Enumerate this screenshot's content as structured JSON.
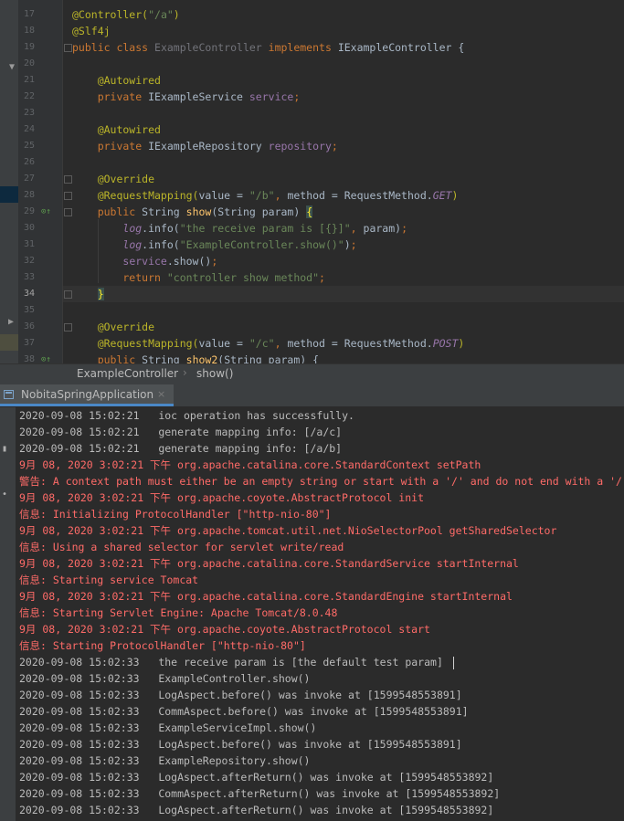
{
  "editor": {
    "lines": [
      {
        "n": "17",
        "tokens": [
          {
            "t": "@Controller(",
            "c": "ann"
          },
          {
            "t": "\"/a\"",
            "c": "str"
          },
          {
            "t": ")",
            "c": "ann"
          }
        ]
      },
      {
        "n": "18",
        "tokens": [
          {
            "t": "@Slf4j",
            "c": "ann"
          }
        ]
      },
      {
        "n": "19",
        "tokens": [
          {
            "t": "public class ",
            "c": "kw"
          },
          {
            "t": "ExampleController ",
            "c": "dim"
          },
          {
            "t": "implements ",
            "c": "kw"
          },
          {
            "t": "IExampleController {",
            "c": ""
          }
        ]
      },
      {
        "n": "20",
        "tokens": []
      },
      {
        "n": "21",
        "tokens": [
          {
            "t": "    @Autowired",
            "c": "ann"
          }
        ]
      },
      {
        "n": "22",
        "tokens": [
          {
            "t": "    private ",
            "c": "kw"
          },
          {
            "t": "IExampleService ",
            "c": ""
          },
          {
            "t": "service",
            "c": "fld"
          },
          {
            "t": ";",
            "c": "kw"
          }
        ]
      },
      {
        "n": "23",
        "tokens": []
      },
      {
        "n": "24",
        "tokens": [
          {
            "t": "    @Autowired",
            "c": "ann"
          }
        ]
      },
      {
        "n": "25",
        "tokens": [
          {
            "t": "    private ",
            "c": "kw"
          },
          {
            "t": "IExampleRepository ",
            "c": ""
          },
          {
            "t": "repository",
            "c": "fld"
          },
          {
            "t": ";",
            "c": "kw"
          }
        ]
      },
      {
        "n": "26",
        "tokens": []
      },
      {
        "n": "27",
        "tokens": [
          {
            "t": "    @Override",
            "c": "ann"
          }
        ]
      },
      {
        "n": "28",
        "tokens": [
          {
            "t": "    @RequestMapping(",
            "c": "ann"
          },
          {
            "t": "value = ",
            "c": ""
          },
          {
            "t": "\"/b\"",
            "c": "str"
          },
          {
            "t": ", ",
            "c": "kw"
          },
          {
            "t": "method = RequestMethod.",
            "c": ""
          },
          {
            "t": "GET",
            "c": "fld ital"
          },
          {
            "t": ")",
            "c": "ann"
          }
        ]
      },
      {
        "n": "29",
        "tokens": [
          {
            "t": "    public ",
            "c": "kw"
          },
          {
            "t": "String ",
            "c": ""
          },
          {
            "t": "show",
            "c": "fn"
          },
          {
            "t": "(String param) ",
            "c": ""
          },
          {
            "t": "{",
            "c": "brace"
          }
        ]
      },
      {
        "n": "30",
        "tokens": [
          {
            "t": "        ",
            "c": ""
          },
          {
            "t": "log",
            "c": "fld ital"
          },
          {
            "t": ".info(",
            "c": ""
          },
          {
            "t": "\"the receive param is [{}]\"",
            "c": "str"
          },
          {
            "t": ", ",
            "c": "kw"
          },
          {
            "t": "param)",
            "c": ""
          },
          {
            "t": ";",
            "c": "kw"
          }
        ]
      },
      {
        "n": "31",
        "tokens": [
          {
            "t": "        ",
            "c": ""
          },
          {
            "t": "log",
            "c": "fld ital"
          },
          {
            "t": ".info(",
            "c": ""
          },
          {
            "t": "\"ExampleController.show()\"",
            "c": "str"
          },
          {
            "t": ")",
            "c": ""
          },
          {
            "t": ";",
            "c": "kw"
          }
        ]
      },
      {
        "n": "32",
        "tokens": [
          {
            "t": "        ",
            "c": ""
          },
          {
            "t": "service",
            "c": "fld"
          },
          {
            "t": ".show()",
            "c": ""
          },
          {
            "t": ";",
            "c": "kw"
          }
        ]
      },
      {
        "n": "33",
        "tokens": [
          {
            "t": "        return ",
            "c": "kw"
          },
          {
            "t": "\"controller show method\"",
            "c": "str"
          },
          {
            "t": ";",
            "c": "kw"
          }
        ]
      },
      {
        "n": "34",
        "tokens": [
          {
            "t": "    ",
            "c": ""
          },
          {
            "t": "}",
            "c": "brace"
          }
        ]
      },
      {
        "n": "35",
        "tokens": []
      },
      {
        "n": "36",
        "tokens": [
          {
            "t": "    @Override",
            "c": "ann"
          }
        ]
      },
      {
        "n": "37",
        "tokens": [
          {
            "t": "    @RequestMapping(",
            "c": "ann"
          },
          {
            "t": "value = ",
            "c": ""
          },
          {
            "t": "\"/c\"",
            "c": "str"
          },
          {
            "t": ", ",
            "c": "kw"
          },
          {
            "t": "method = RequestMethod.",
            "c": ""
          },
          {
            "t": "POST",
            "c": "fld ital"
          },
          {
            "t": ")",
            "c": "ann"
          }
        ]
      },
      {
        "n": "38",
        "tokens": [
          {
            "t": "    public ",
            "c": "kw"
          },
          {
            "t": "String ",
            "c": ""
          },
          {
            "t": "show2",
            "c": "fn"
          },
          {
            "t": "(String param) {",
            "c": ""
          }
        ]
      }
    ],
    "current_line": "34"
  },
  "breadcrumb": {
    "class_name": "ExampleController",
    "separator": "›",
    "method_name": "show()"
  },
  "run_panel": {
    "tab_label": "NobitaSpringApplication",
    "close_glyph": "×"
  },
  "console": {
    "lines": [
      {
        "kind": "log",
        "text": "2020-09-08 15:02:21   ioc operation has successfully."
      },
      {
        "kind": "log",
        "text": "2020-09-08 15:02:21   generate mapping info: [/a/c]"
      },
      {
        "kind": "log",
        "text": "2020-09-08 15:02:21   generate mapping info: [/a/b]"
      },
      {
        "kind": "err",
        "text": "9月 08, 2020 3:02:21 下午 org.apache.catalina.core.StandardContext setPath"
      },
      {
        "kind": "err",
        "text": "警告: A context path must either be an empty string or start with a '/' and do not end with a '/'"
      },
      {
        "kind": "err",
        "text": "9月 08, 2020 3:02:21 下午 org.apache.coyote.AbstractProtocol init"
      },
      {
        "kind": "err",
        "text": "信息: Initializing ProtocolHandler [\"http-nio-80\"]"
      },
      {
        "kind": "err",
        "text": "9月 08, 2020 3:02:21 下午 org.apache.tomcat.util.net.NioSelectorPool getSharedSelector"
      },
      {
        "kind": "err",
        "text": "信息: Using a shared selector for servlet write/read"
      },
      {
        "kind": "err",
        "text": "9月 08, 2020 3:02:21 下午 org.apache.catalina.core.StandardService startInternal"
      },
      {
        "kind": "err",
        "text": "信息: Starting service Tomcat"
      },
      {
        "kind": "err",
        "text": "9月 08, 2020 3:02:21 下午 org.apache.catalina.core.StandardEngine startInternal"
      },
      {
        "kind": "err",
        "text": "信息: Starting Servlet Engine: Apache Tomcat/8.0.48"
      },
      {
        "kind": "err",
        "text": "9月 08, 2020 3:02:21 下午 org.apache.coyote.AbstractProtocol start"
      },
      {
        "kind": "err",
        "text": "信息: Starting ProtocolHandler [\"http-nio-80\"]"
      },
      {
        "kind": "log",
        "text": "2020-09-08 15:02:33   the receive param is [the default test param]"
      },
      {
        "kind": "log",
        "text": "2020-09-08 15:02:33   ExampleController.show()"
      },
      {
        "kind": "log",
        "text": "2020-09-08 15:02:33   LogAspect.before() was invoke at [1599548553891]"
      },
      {
        "kind": "log",
        "text": "2020-09-08 15:02:33   CommAspect.before() was invoke at [1599548553891]"
      },
      {
        "kind": "log",
        "text": "2020-09-08 15:02:33   ExampleServiceImpl.show()"
      },
      {
        "kind": "log",
        "text": "2020-09-08 15:02:33   LogAspect.before() was invoke at [1599548553891]"
      },
      {
        "kind": "log",
        "text": "2020-09-08 15:02:33   ExampleRepository.show()"
      },
      {
        "kind": "log",
        "text": "2020-09-08 15:02:33   LogAspect.afterReturn() was invoke at [1599548553892]"
      },
      {
        "kind": "log",
        "text": "2020-09-08 15:02:33   CommAspect.afterReturn() was invoke at [1599548553892]"
      },
      {
        "kind": "log",
        "text": "2020-09-08 15:02:33   LogAspect.afterReturn() was invoke at [1599548553892]"
      }
    ]
  },
  "colors": {
    "editor_bg": "#2b2b2b",
    "annotation": "#bbb529",
    "keyword": "#cc7832",
    "string": "#6a8759",
    "field": "#9876aa",
    "method": "#ffc66d",
    "console_error": "#ff6b68",
    "console_text": "#bbbbbb",
    "tab_underline": "#4a88c7"
  },
  "icons": {
    "gutter_override": "override-implements-icon",
    "fold_marker": "fold-marker-icon",
    "run_tab": "console-icon"
  }
}
